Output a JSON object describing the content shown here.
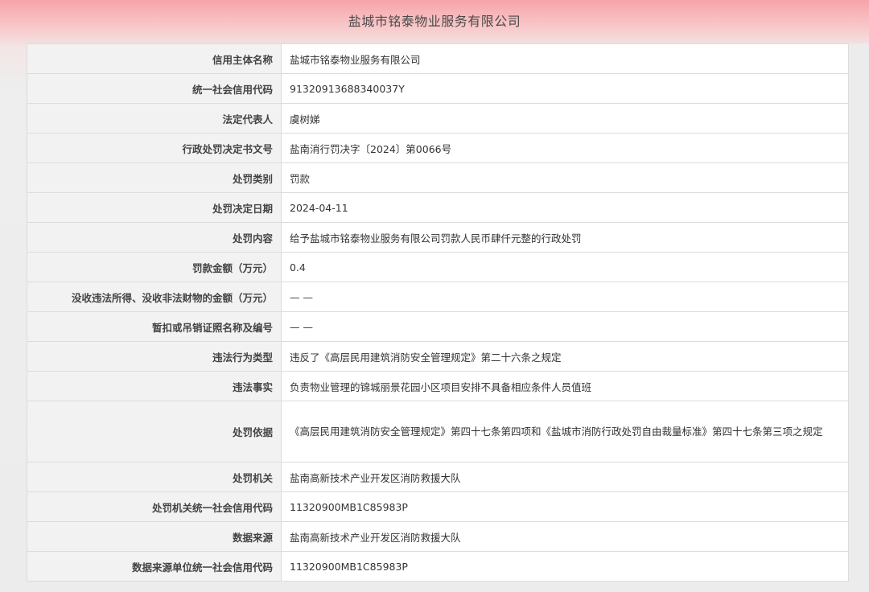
{
  "page": {
    "title": "盐城市铭泰物业服务有限公司"
  },
  "rows": [
    {
      "label": "信用主体名称",
      "value": "盐城市铭泰物业服务有限公司"
    },
    {
      "label": "统一社会信用代码",
      "value": "91320913688340037Y"
    },
    {
      "label": "法定代表人",
      "value": "虞树娣"
    },
    {
      "label": "行政处罚决定书文号",
      "value": "盐南消行罚决字〔2024〕第0066号"
    },
    {
      "label": "处罚类别",
      "value": "罚款"
    },
    {
      "label": "处罚决定日期",
      "value": "2024-04-11"
    },
    {
      "label": "处罚内容",
      "value": "给予盐城市铭泰物业服务有限公司罚款人民币肆仟元整的行政处罚"
    },
    {
      "label": "罚款金额（万元）",
      "value": "0.4"
    },
    {
      "label": "没收违法所得、没收非法财物的金额（万元）",
      "value": "— —"
    },
    {
      "label": "暂扣或吊销证照名称及编号",
      "value": "— —"
    },
    {
      "label": "违法行为类型",
      "value": "违反了《高层民用建筑消防安全管理规定》第二十六条之规定"
    },
    {
      "label": "违法事实",
      "value": "负责物业管理的锦城丽景花园小区项目安排不具备相应条件人员值班"
    },
    {
      "label": "处罚依据",
      "value": "《高层民用建筑消防安全管理规定》第四十七条第四项和《盐城市消防行政处罚自由裁量标准》第四十七条第三项之规定"
    },
    {
      "label": "处罚机关",
      "value": "盐南高新技术产业开发区消防救援大队"
    },
    {
      "label": "处罚机关统一社会信用代码",
      "value": "11320900MB1C85983P"
    },
    {
      "label": "数据来源",
      "value": "盐南高新技术产业开发区消防救援大队"
    },
    {
      "label": "数据来源单位统一社会信用代码",
      "value": "11320900MB1C85983P"
    }
  ]
}
